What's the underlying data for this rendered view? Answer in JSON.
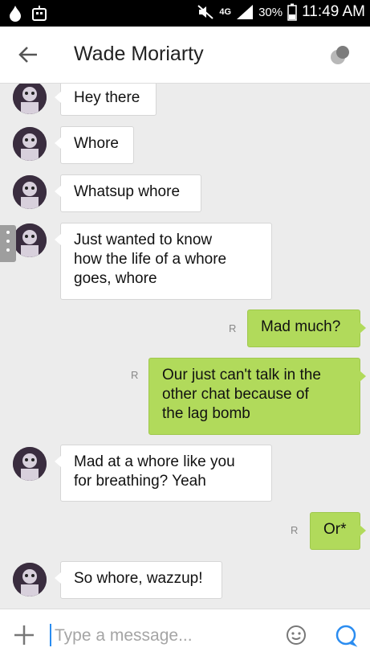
{
  "statusbar": {
    "network": "4G",
    "battery": "30%",
    "time": "11:49 AM",
    "icons": [
      "flame-icon",
      "robot-icon",
      "mute-icon",
      "signal-icon",
      "battery-icon"
    ]
  },
  "header": {
    "title": "Wade Moriarty",
    "back_icon": "back-arrow-icon",
    "menu_icon": "more-dot-icon"
  },
  "messages": [
    {
      "dir": "in",
      "text": "Hey there"
    },
    {
      "dir": "in",
      "text": "Whore"
    },
    {
      "dir": "in",
      "text": "Whatsup whore"
    },
    {
      "dir": "in",
      "lines": [
        "Just wanted to know",
        "how the life of a whore",
        "goes, whore"
      ]
    },
    {
      "dir": "out",
      "text": "Mad much?",
      "receipt": "R"
    },
    {
      "dir": "out",
      "lines": [
        "Our just can't talk in the",
        "other chat because of",
        "the lag bomb"
      ],
      "receipt": "R"
    },
    {
      "dir": "in",
      "lines": [
        "Mad at a whore like you",
        "for breathing? Yeah"
      ]
    },
    {
      "dir": "out",
      "text": "Or*",
      "receipt": "R"
    },
    {
      "dir": "in",
      "text": "So whore, wazzup!"
    }
  ],
  "input": {
    "placeholder": "Type a message...",
    "add_icon": "plus-icon",
    "emoji_icon": "smiley-icon",
    "send_icon": "chat-bubble-icon"
  },
  "colors": {
    "outgoing_bubble": "#b1da5b",
    "incoming_bubble": "#ffffff",
    "background": "#ececec",
    "accent": "#2a8cf0"
  }
}
